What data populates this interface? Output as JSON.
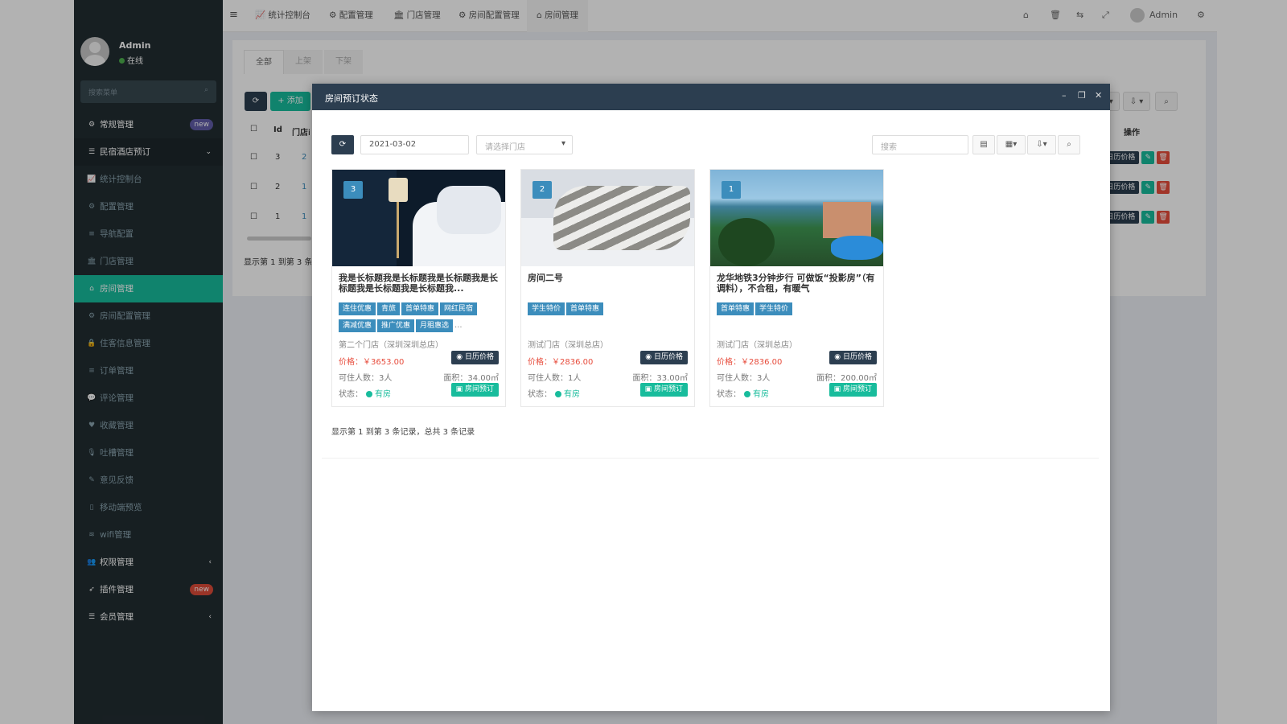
{
  "sidebar": {
    "user": {
      "name": "Admin",
      "status": "在线"
    },
    "search_placeholder": "搜索菜单",
    "items": [
      {
        "label": "常规管理",
        "icon": "cogs-icon",
        "badge": "new",
        "badge_color": "#605ca8",
        "level": "top"
      },
      {
        "label": "民宿酒店预订",
        "icon": "list-icon",
        "chevron": "⌄",
        "level": "header"
      },
      {
        "label": "统计控制台",
        "icon": "chart-icon",
        "level": "sub"
      },
      {
        "label": "配置管理",
        "icon": "gear-icon",
        "level": "sub"
      },
      {
        "label": "导航配置",
        "icon": "bars-icon",
        "level": "sub"
      },
      {
        "label": "门店管理",
        "icon": "bank-icon",
        "level": "sub"
      },
      {
        "label": "房间管理",
        "icon": "home-icon",
        "level": "active"
      },
      {
        "label": "房间配置管理",
        "icon": "gear-icon",
        "level": "sub"
      },
      {
        "label": "住客信息管理",
        "icon": "lock-icon",
        "level": "sub"
      },
      {
        "label": "订单管理",
        "icon": "bars-icon",
        "level": "sub"
      },
      {
        "label": "评论管理",
        "icon": "comments-icon",
        "level": "sub"
      },
      {
        "label": "收藏管理",
        "icon": "heart-icon",
        "level": "sub"
      },
      {
        "label": "吐槽管理",
        "icon": "mic-icon",
        "level": "sub"
      },
      {
        "label": "意见反馈",
        "icon": "pencil-icon",
        "level": "sub"
      },
      {
        "label": "移动端预览",
        "icon": "mobile-icon",
        "level": "sub"
      },
      {
        "label": "wifi管理",
        "icon": "wifi-icon",
        "level": "sub"
      },
      {
        "label": "权限管理",
        "icon": "group-icon",
        "chevron": "‹",
        "level": "top"
      },
      {
        "label": "插件管理",
        "icon": "rocket-icon",
        "badge": "new",
        "badge_color": "#dd4b39",
        "level": "top"
      },
      {
        "label": "会员管理",
        "icon": "list-icon",
        "chevron": "‹",
        "level": "top"
      }
    ]
  },
  "topbar": {
    "tabs": [
      {
        "label": "统计控制台",
        "icon": "chart-icon"
      },
      {
        "label": "配置管理",
        "icon": "gear-icon"
      },
      {
        "label": "门店管理",
        "icon": "bank-icon"
      },
      {
        "label": "房间配置管理",
        "icon": "gear-icon"
      },
      {
        "label": "房间管理",
        "icon": "home-icon"
      }
    ],
    "user": "Admin"
  },
  "background": {
    "tabs": [
      "全部",
      "上架",
      "下架"
    ],
    "add_label": "添加",
    "col_id": "Id",
    "col_store": "门店id",
    "col_ops": "操作",
    "rows": [
      {
        "id": "3",
        "store": "2"
      },
      {
        "id": "2",
        "store": "1"
      },
      {
        "id": "1",
        "store": "1"
      }
    ],
    "calendar_label": "日历价格",
    "pager": "显示第 1 到第 3 条"
  },
  "modal": {
    "title": "房间预订状态",
    "date": "2021-03-02",
    "store_placeholder": "请选择门店",
    "search_placeholder": "搜索",
    "pager": "显示第 1 到第 3 条记录，总共 3 条记录",
    "cards": [
      {
        "num": "3",
        "title": "我是长标题我是长标题我是长标题我是长标题我是长标题我是长标题我...",
        "tags": [
          "连住优惠",
          "青旅",
          "首单特惠",
          "网红民宿",
          "满减优惠",
          "推广优惠",
          "月租惠选"
        ],
        "more": "...",
        "store": "第二个门店（深圳深圳总店）",
        "price": "价格：￥3653.00",
        "capacity": "可住人数：3人",
        "area": "面积：34.00㎡",
        "status_label": "状态：",
        "status": "有房"
      },
      {
        "num": "2",
        "title": "房间二号",
        "tags": [
          "学生特价",
          "首单特惠"
        ],
        "more": "",
        "store": "测试门店（深圳总店）",
        "price": "价格：￥2836.00",
        "capacity": "可住人数：1人",
        "area": "面积：33.00㎡",
        "status_label": "状态：",
        "status": "有房"
      },
      {
        "num": "1",
        "title": "龙华地铁3分钟步行 可做饭“投影房”（有调料），不合租，有暖气",
        "tags": [
          "首单特惠",
          "学生特价"
        ],
        "more": "",
        "store": "测试门店（深圳总店）",
        "price": "价格：￥2836.00",
        "capacity": "可住人数：3人",
        "area": "面积：200.00㎡",
        "status_label": "状态：",
        "status": "有房"
      }
    ],
    "calendar_label": "日历价格",
    "book_label": "房间预订"
  },
  "colors": {
    "sidebar_bg": "#222d32",
    "active": "#18bc9c",
    "primary": "#3c8dbc",
    "modal_header": "#2c3e50",
    "price": "#e74c3c"
  }
}
